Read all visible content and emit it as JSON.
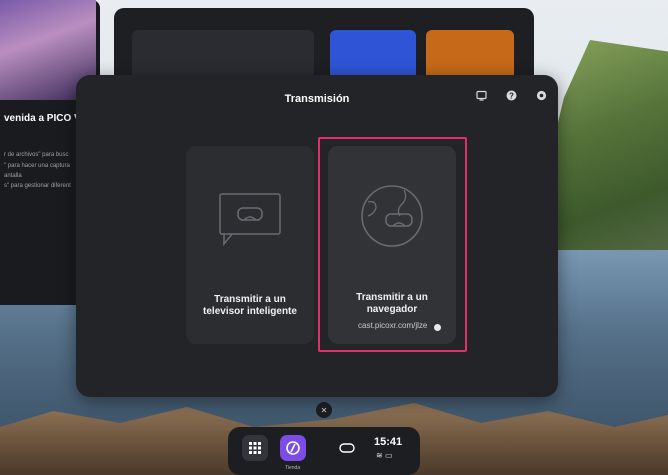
{
  "dialog": {
    "title": "Transmisión"
  },
  "options": [
    {
      "label": "Transmitir a un televisor inteligente"
    },
    {
      "label": "Transmitir a un navegador",
      "url": "cast.picoxr.com/jlze"
    }
  ],
  "left_panel": {
    "title": "venida a PICO VI",
    "lines": [
      "r de archivos\" para busc",
      "\" para hacer una captura",
      "antalla",
      "s\" para gestionar diferent"
    ]
  },
  "dock": {
    "time": "15:41",
    "store_label": "Tienda"
  },
  "colors": {
    "highlight": "#e0306a",
    "dialog_bg": "#232427",
    "store_accent": "#7b4ce6"
  },
  "icons": [
    "screen-icon",
    "help-icon",
    "settings-icon",
    "close-icon",
    "apps-grid-icon",
    "store-icon",
    "headset-icon",
    "wifi-icon",
    "battery-icon",
    "tv-cast-icon",
    "globe-cast-icon"
  ]
}
